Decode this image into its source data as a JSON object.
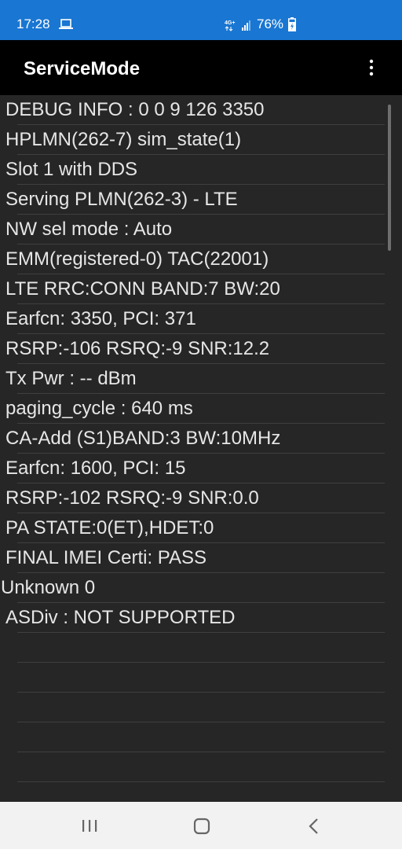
{
  "status_bar": {
    "time": "17:28",
    "network_badge": "4G+",
    "battery_percent": "76%",
    "icons": [
      "laptop-icon",
      "network-4g-icon",
      "signal-bars-icon",
      "battery-charging-icon"
    ]
  },
  "app_bar": {
    "title": "ServiceMode",
    "menu_icon": "more-vert-icon"
  },
  "info_lines": [
    "DEBUG INFO : 0 0 9 126 3350",
    "HPLMN(262-7) sim_state(1)",
    "Slot 1 with DDS",
    "Serving PLMN(262-3) - LTE",
    "NW sel mode : Auto",
    "EMM(registered-0) TAC(22001)",
    "LTE RRC:CONN BAND:7 BW:20",
    "Earfcn: 3350, PCI: 371",
    "RSRP:-106 RSRQ:-9 SNR:12.2",
    "Tx Pwr : -- dBm",
    "paging_cycle : 640 ms",
    "CA-Add (S1)BAND:3 BW:10MHz",
    "Earfcn: 1600, PCI: 15",
    "RSRP:-102 RSRQ:-9 SNR:0.0",
    "PA STATE:0(ET),HDET:0",
    "FINAL IMEI Certi: PASS",
    "Unknown 0",
    "ASDiv : NOT SUPPORTED"
  ],
  "nav_bar": {
    "icons": [
      "recent-apps-icon",
      "home-icon",
      "back-icon"
    ]
  },
  "colors": {
    "status_bar": "#1976d2",
    "app_bar": "#000000",
    "content_bg": "#262626",
    "text": "#e6e6e6",
    "nav_bar": "#f2f2f2"
  }
}
